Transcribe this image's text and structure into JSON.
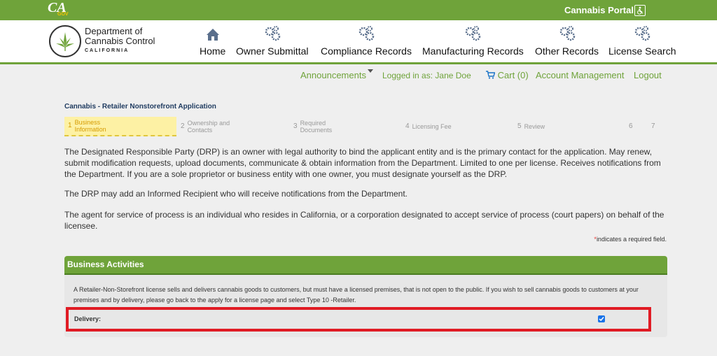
{
  "topbar": {
    "ca_logo_letters": "CA",
    "ca_logo_sub": "GOV",
    "portal_title": "Cannabis Portal",
    "accessibility_icon": "accessibility-icon"
  },
  "header": {
    "dept_name_line1": "Department of",
    "dept_name_line2": "Cannabis Control",
    "dept_state": "CALIFORNIA",
    "nav": [
      {
        "label": "Home",
        "icon": "home-icon"
      },
      {
        "label": "Owner Submittal",
        "icon": "gears-icon"
      },
      {
        "label": "Compliance Records",
        "icon": "gears-icon"
      },
      {
        "label": "Manufacturing Records",
        "icon": "gears-icon"
      },
      {
        "label": "Other Records",
        "icon": "gears-icon"
      },
      {
        "label": "License Search",
        "icon": "gears-icon"
      }
    ]
  },
  "subnav": {
    "announcements": "Announcements",
    "logged_in": "Logged in as: Jane Doe",
    "cart": "Cart (0)",
    "account": "Account Management",
    "logout": "Logout"
  },
  "app": {
    "title": "Cannabis - Retailer Nonstorefront Application",
    "steps": [
      {
        "num": "1",
        "label1": "Business",
        "label2": "Information",
        "active": true
      },
      {
        "num": "2",
        "label1": "Ownership and",
        "label2": "Contacts",
        "active": false
      },
      {
        "num": "3",
        "label1": "Required",
        "label2": "Documents",
        "active": false
      },
      {
        "num": "4",
        "label1": "Licensing Fee",
        "label2": "",
        "active": false
      },
      {
        "num": "5",
        "label1": "Review",
        "label2": "",
        "active": false
      },
      {
        "num": "6",
        "label1": "",
        "label2": "",
        "active": false
      },
      {
        "num": "7",
        "label1": "",
        "label2": "",
        "active": false
      }
    ],
    "para1": "The Designated Responsible Party (DRP) is an owner with legal authority to bind the applicant entity and is the primary contact for the application. May renew, submit modification requests, upload documents, communicate & obtain information from the Department. Limited to one per license. Receives notifications from the Department. If you are a sole proprietor or business entity with one owner, you must designate yourself as the DRP.",
    "para2": "The DRP may add an Informed Recipient who will receive notifications from the Department.",
    "para3": "The agent for service of process is an individual who resides in California, or a corporation designated to accept service of process (court papers) on behalf of the licensee.",
    "required_star": "*",
    "required_note": "indicates a required field."
  },
  "panel": {
    "title": "Business Activities",
    "description": "A Retailer-Non-Storefront license sells and delivers cannabis goods to customers, but must have a licensed premises, that is not open to the public. If you wish to sell cannabis goods to customers at your premises and by delivery, please go back to the apply for a license page and select Type 10 -Retailer.",
    "delivery_label": "Delivery:",
    "delivery_checked": true
  },
  "colors": {
    "brand_green": "#6fa33a",
    "active_step_bg": "#fdf1a4",
    "highlight_red": "#e01b24"
  }
}
